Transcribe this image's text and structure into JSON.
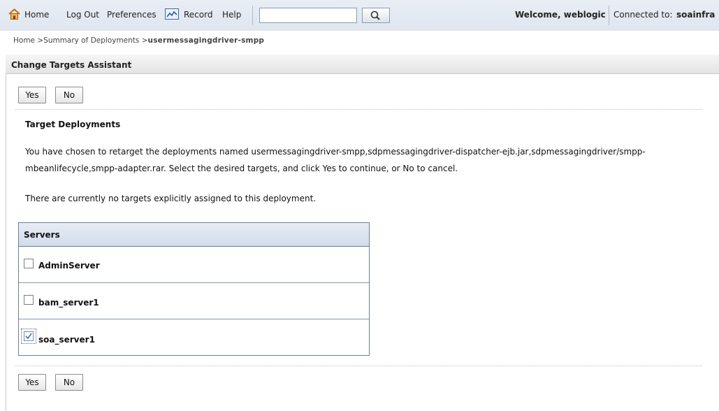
{
  "toolbar": {
    "home": "Home",
    "logout": "Log Out",
    "preferences": "Preferences",
    "record": "Record",
    "help": "Help",
    "search_value": "",
    "welcome": "Welcome, weblogic",
    "connected_label": "Connected to:",
    "connected_value": "soainfra"
  },
  "breadcrumb": {
    "home": "Home >",
    "summary": "Summary of Deployments >",
    "current": "usermessagingdriver-smpp"
  },
  "assistant": {
    "title": "Change Targets Assistant",
    "yes_label": "Yes",
    "no_label": "No",
    "heading": "Target Deployments",
    "message_line1": "You have chosen to retarget the deployments named usermessagingdriver-smpp,sdpmessagingdriver-dispatcher-ejb.jar,sdpmessagingdriver/smpp-",
    "message_line2": "mbeanlifecycle,smpp-adapter.rar. Select the desired targets, and click Yes to continue, or No to cancel.",
    "no_targets_note": "There are currently no targets explicitly assigned to this deployment."
  },
  "servers": {
    "header": "Servers",
    "rows": [
      {
        "name": "AdminServer",
        "checked": false
      },
      {
        "name": "bam_server1",
        "checked": false
      },
      {
        "name": "soa_server1",
        "checked": true
      }
    ]
  },
  "icons": {
    "home": "home-icon",
    "record": "record-icon",
    "search": "magnifier-icon",
    "checkmark": "checkmark-icon"
  },
  "colors": {
    "toolbar_bg": "#e3e9f1",
    "table_header_bg": "#dbe3ef",
    "check_color": "#3a6fb0",
    "home_roof": "#d0711d"
  }
}
